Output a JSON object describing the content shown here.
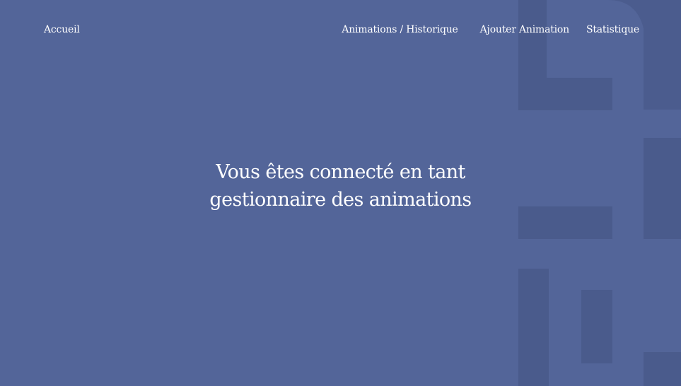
{
  "nav": {
    "home_label": "Accueil",
    "links": [
      {
        "label": "Animations / Historique"
      },
      {
        "label": "Ajouter Animation"
      },
      {
        "label": "Statistique"
      }
    ]
  },
  "hero": {
    "line1": "Vous êtes connecté en tant",
    "line2": "gestionnaire des animations"
  },
  "colors": {
    "background": "#536599",
    "decor": "#4a5a8b",
    "text": "#ffffff"
  }
}
